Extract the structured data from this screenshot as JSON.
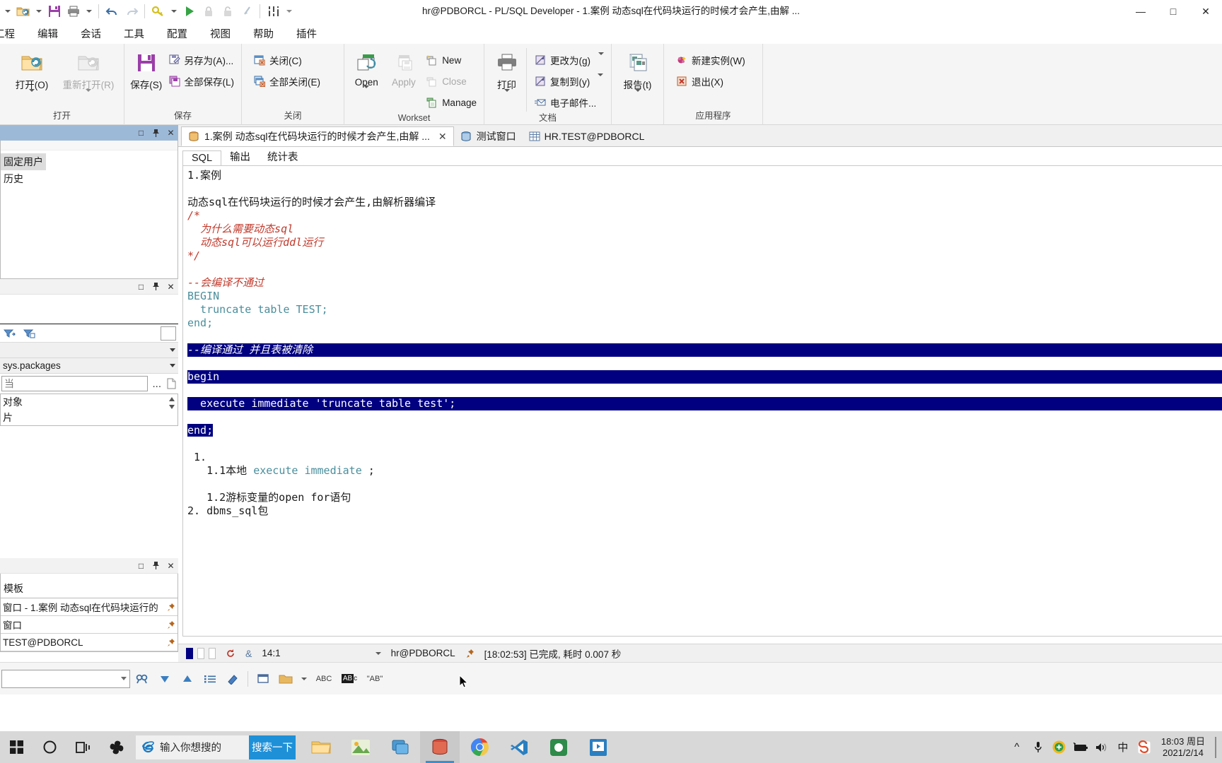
{
  "window": {
    "title": "hr@PDBORCL - PL/SQL Developer - 1.案例 动态sql在代码块运行的时候才会产生,由解 ...",
    "minimize": "—",
    "maximize": "□",
    "close": "✕"
  },
  "quick_access": {
    "items": [
      {
        "name": "dropdown-caret",
        "label": ""
      },
      {
        "name": "open-folder-icon",
        "label": ""
      },
      {
        "name": "open-dropdown-caret",
        "label": ""
      },
      {
        "name": "save-icon",
        "label": ""
      },
      {
        "name": "print-icon",
        "label": ""
      },
      {
        "name": "print-dropdown-caret",
        "label": ""
      },
      {
        "name": "undo-icon",
        "label": ""
      },
      {
        "name": "redo-icon",
        "label": ""
      },
      {
        "name": "key-icon",
        "label": ""
      },
      {
        "name": "key-dropdown-caret",
        "label": ""
      },
      {
        "name": "run-icon",
        "label": ""
      },
      {
        "name": "lock-icon",
        "label": ""
      },
      {
        "name": "unlock-icon",
        "label": ""
      },
      {
        "name": "break-icon",
        "label": ""
      },
      {
        "name": "settings-sliders-icon",
        "label": ""
      },
      {
        "name": "more-caret",
        "label": ""
      }
    ]
  },
  "menubar": {
    "items": [
      "工程",
      "编辑",
      "会话",
      "工具",
      "配置",
      "视图",
      "帮助",
      "插件"
    ]
  },
  "ribbon": {
    "groups": [
      {
        "label": "打开",
        "big": [
          {
            "label": "打开(O)",
            "disabled": false,
            "icon": "open-folder-icon",
            "dropdown": true
          },
          {
            "label": "重新打开(R)",
            "disabled": true,
            "icon": "reopen-folder-icon",
            "dropdown": true
          }
        ],
        "small": []
      },
      {
        "label": "保存",
        "big": [
          {
            "label": "保存(S)",
            "disabled": false,
            "icon": "floppy-save-icon",
            "dropdown": false
          }
        ],
        "small": [
          {
            "label": "另存为(A)...",
            "disabled": false,
            "icon": "save-as-icon",
            "dropdown": false
          },
          {
            "label": "全部保存(L)",
            "disabled": false,
            "icon": "save-all-icon",
            "dropdown": false
          }
        ]
      },
      {
        "label": "关闭",
        "big": [],
        "small": [
          {
            "label": "关闭(C)",
            "disabled": false,
            "icon": "close-doc-icon",
            "dropdown": false
          },
          {
            "label": "全部关闭(E)",
            "disabled": false,
            "icon": "close-all-icon",
            "dropdown": false
          }
        ]
      },
      {
        "label": "Workset",
        "big": [
          {
            "label": "Open",
            "disabled": false,
            "icon": "workset-open-icon",
            "dropdown": true
          },
          {
            "label": "Apply",
            "disabled": true,
            "icon": "workset-apply-icon",
            "dropdown": false
          }
        ],
        "small": [
          {
            "label": "New",
            "disabled": false,
            "icon": "new-workset-icon",
            "dropdown": false
          },
          {
            "label": "Close",
            "disabled": true,
            "icon": "close-workset-icon",
            "dropdown": false
          },
          {
            "label": "Manage",
            "disabled": false,
            "icon": "manage-workset-icon",
            "dropdown": false
          }
        ]
      },
      {
        "label": "文档",
        "big": [
          {
            "label": "打印",
            "disabled": false,
            "icon": "printer-icon",
            "dropdown": true
          }
        ],
        "small": [
          {
            "label": "更改为(g)",
            "disabled": false,
            "icon": "change-to-icon",
            "dropdown": true
          },
          {
            "label": "复制到(y)",
            "disabled": false,
            "icon": "copy-to-icon",
            "dropdown": true
          },
          {
            "label": "电子邮件...",
            "disabled": false,
            "icon": "email-icon",
            "dropdown": false
          }
        ]
      },
      {
        "label": "",
        "big": [
          {
            "label": "报告(t)",
            "disabled": false,
            "icon": "report-icon",
            "dropdown": true
          }
        ],
        "small": []
      },
      {
        "label": "应用程序",
        "big": [],
        "small": [
          {
            "label": "新建实例(W)",
            "disabled": false,
            "icon": "new-instance-icon",
            "dropdown": false
          },
          {
            "label": "退出(X)",
            "disabled": false,
            "icon": "exit-icon",
            "dropdown": false
          }
        ]
      }
    ]
  },
  "sidebar": {
    "panel1": {
      "title_buttons": [
        "□",
        "📌",
        "✕"
      ],
      "items": [
        "固定用户",
        "历史"
      ]
    },
    "panel2": {
      "title_buttons": [
        "□",
        "📌",
        "✕"
      ],
      "browser_combo": "",
      "schema_combo": "sys.packages",
      "filter_value": "当",
      "filter_more": "...",
      "tree_items": [
        "对象",
        "片"
      ]
    },
    "panel3": {
      "title_buttons": [
        "□",
        "📌",
        "✕"
      ],
      "header": "模板",
      "windows": [
        {
          "label": "窗口 - 1.案例 动态sql在代码块运行的",
          "pinned": "📌"
        },
        {
          "label": "窗口",
          "pinned": "📌"
        },
        {
          "label": "TEST@PDBORCL",
          "pinned": "📌"
        }
      ]
    }
  },
  "editor": {
    "tabs": [
      {
        "label": "1.案例 动态sql在代码块运行的时候才会产生,由解 ...",
        "icon": "sql-window-icon",
        "active": true,
        "closable": true
      },
      {
        "label": "测试窗口",
        "icon": "test-window-icon",
        "active": false,
        "closable": false
      },
      {
        "label": "HR.TEST@PDBORCL",
        "icon": "table-icon",
        "active": false,
        "closable": false
      }
    ],
    "subtabs": [
      {
        "label": "SQL",
        "active": true
      },
      {
        "label": "输出",
        "active": false
      },
      {
        "label": "统计表",
        "active": false
      }
    ],
    "code_lines": [
      {
        "text": "1.案例",
        "type": "plain"
      },
      {
        "text": "",
        "type": "plain"
      },
      {
        "text": "动态sql在代码块运行的时候才会产生,由解析器编译",
        "type": "plain"
      },
      {
        "text": "/*",
        "type": "comment"
      },
      {
        "text": "  为什么需要动态sql",
        "type": "comment"
      },
      {
        "text": "  动态sql可以运行ddl运行",
        "type": "comment"
      },
      {
        "text": "*/",
        "type": "comment"
      },
      {
        "text": "",
        "type": "plain"
      },
      {
        "text": "--会编译不通过",
        "type": "comment"
      },
      {
        "text": "BEGIN",
        "type": "keyword"
      },
      {
        "text": "  truncate table TEST;",
        "type": "keyword-stmt"
      },
      {
        "text": "end;",
        "type": "keyword"
      },
      {
        "text": "",
        "type": "plain"
      },
      {
        "text": "--编译通过 并且表被清除",
        "type": "selected-comment"
      },
      {
        "text": "begin",
        "type": "selected"
      },
      {
        "text": "  execute immediate 'truncate table test';",
        "type": "selected"
      },
      {
        "text": "end;",
        "type": "selected-partial"
      },
      {
        "text": "",
        "type": "plain"
      },
      {
        "text": " 1.",
        "type": "plain"
      },
      {
        "text": "   1.1本地 execute immediate ;",
        "type": "mixed"
      },
      {
        "text": "",
        "type": "plain"
      },
      {
        "text": "   1.2游标变量的open for语句",
        "type": "plain"
      },
      {
        "text": "2. dbms_sql包",
        "type": "plain"
      }
    ],
    "status": {
      "position": "14:1",
      "connection": "hr@PDBORCL",
      "message": "[18:02:53] 已完成, 耗时 0.007 秒"
    }
  },
  "bottom_toolbar": {
    "combo_value": "",
    "buttons": [
      {
        "name": "find-icon",
        "label": "🔍"
      },
      {
        "name": "find-next-icon",
        "label": "▼"
      },
      {
        "name": "find-prev-icon",
        "label": "▲"
      },
      {
        "name": "list-icon",
        "label": "☰"
      },
      {
        "name": "eraser-icon",
        "label": "◆"
      },
      {
        "name": "window-icon",
        "label": "▭"
      },
      {
        "name": "folder-icon",
        "label": "📁"
      },
      {
        "name": "folder-dropdown-caret",
        "label": "▾"
      },
      {
        "name": "abc-icon",
        "label": "ABC"
      },
      {
        "name": "abc-invert-icon",
        "label": "ABC"
      },
      {
        "name": "quoted-ab-icon",
        "label": "\"AB\""
      }
    ]
  },
  "taskbar": {
    "start": "⊞",
    "cortana": "○",
    "taskview": "❑",
    "search_placeholder": "输入你想搜的",
    "search_button": "搜索一下",
    "apps": [
      {
        "name": "file-explorer",
        "active": false
      },
      {
        "name": "photos-app",
        "active": false
      },
      {
        "name": "virtualbox-app",
        "active": false
      },
      {
        "name": "database-app",
        "active": true
      },
      {
        "name": "chrome-app",
        "active": false
      },
      {
        "name": "vscode-app",
        "active": false
      },
      {
        "name": "green-app",
        "active": false
      },
      {
        "name": "blue-media-app",
        "active": false
      }
    ],
    "tray": {
      "chevron": "^",
      "mic": "mic-icon",
      "shield": "security-icon",
      "battery": "battery-icon",
      "volume": "volume-icon",
      "ime": "中",
      "sogou": "S",
      "time": "18:03 周日",
      "date": "2021/2/14"
    }
  }
}
